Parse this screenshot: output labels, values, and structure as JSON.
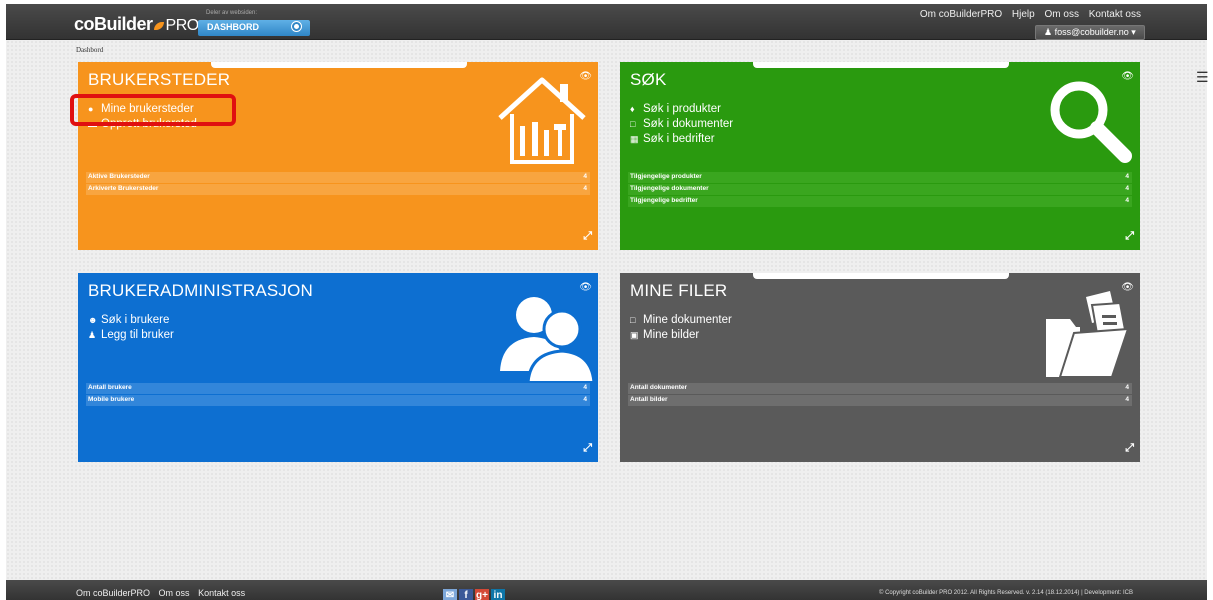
{
  "header": {
    "logo_main": "coBuilder",
    "logo_suffix": "PRO",
    "site_caption": "Deler av websiden:",
    "dashboard_label": "DASHBORD",
    "links": [
      "Om coBuilderPRO",
      "Hjelp",
      "Om oss",
      "Kontakt oss"
    ],
    "user": "foss@cobuilder.no"
  },
  "breadcrumb": "Dashbord",
  "tiles": [
    {
      "title": "BRUKERSTEDER",
      "color": "#f7941d",
      "links": [
        "Mine brukersteder",
        "Opprett brukersted"
      ],
      "stats": [
        {
          "label": "Aktive Brukersteder",
          "value": "4"
        },
        {
          "label": "Arkiverte Brukersteder",
          "value": "4"
        }
      ]
    },
    {
      "title": "SØK",
      "color": "#2a9a0f",
      "links": [
        "Søk i produkter",
        "Søk i dokumenter",
        "Søk i bedrifter"
      ],
      "stats": [
        {
          "label": "Tilgjengelige produkter",
          "value": "4"
        },
        {
          "label": "Tilgjengelige dokumenter",
          "value": "4"
        },
        {
          "label": "Tilgjengelige bedrifter",
          "value": "4"
        }
      ]
    },
    {
      "title": "BRUKERADMINISTRASJON",
      "color": "#0d6fd1",
      "links": [
        "Søk i brukere",
        "Legg til bruker"
      ],
      "stats": [
        {
          "label": "Antall brukere",
          "value": "4"
        },
        {
          "label": "Mobile brukere",
          "value": "4"
        }
      ]
    },
    {
      "title": "MINE FILER",
      "color": "#5a5a5a",
      "links": [
        "Mine dokumenter",
        "Mine bilder"
      ],
      "stats": [
        {
          "label": "Antall dokumenter",
          "value": "4"
        },
        {
          "label": "Antall bilder",
          "value": "4"
        }
      ]
    }
  ],
  "footer": {
    "links": [
      "Om coBuilderPRO",
      "Om oss",
      "Kontakt oss"
    ],
    "social": [
      "mail-icon",
      "facebook-icon",
      "google-plus-icon",
      "linkedin-icon"
    ],
    "copyright": "© Copyright coBuilder PRO 2012. All Rights Reserved. v. 2.14 (18.12.2014) | Development: ICB"
  }
}
